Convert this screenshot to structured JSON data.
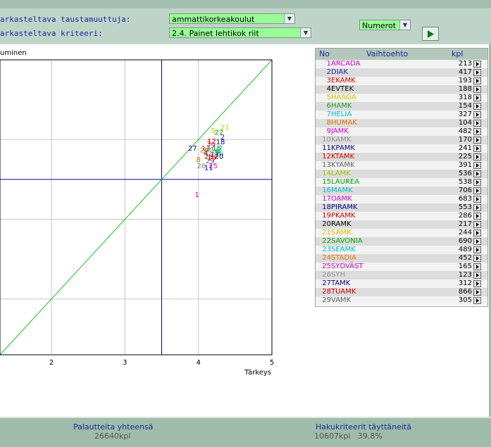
{
  "header": {
    "background_label": "arkasteltava taustamuuttuja:",
    "background_value": "ammattikorkeakoulut",
    "criterion_label": "arkasteltava kriteeri:",
    "criterion_value": "2.4. Painet lehtikok riit",
    "display_value": "Numerot"
  },
  "chart_data": {
    "type": "scatter",
    "title": "uminen",
    "xlabel": "Tärkeys",
    "x_ticks": [
      "2",
      "3",
      "4",
      "5"
    ],
    "xlim": [
      1.3,
      5
    ],
    "ylim": [
      1.3,
      5
    ],
    "grid": true,
    "reference_lines": {
      "x": 3.5,
      "y": 3.5,
      "diagonal": true
    },
    "points": [
      {
        "label": "1",
        "x": 3.98,
        "y": 3.28,
        "color": "#cc00cc"
      },
      {
        "label": "2",
        "x": 4.33,
        "y": 4.0,
        "color": "#1a1aa0"
      },
      {
        "label": "3",
        "x": 4.14,
        "y": 3.92,
        "color": "#cc0000"
      },
      {
        "label": "4",
        "x": 4.1,
        "y": 3.8,
        "color": "#000000"
      },
      {
        "label": "5",
        "x": 4.2,
        "y": 4.08,
        "color": "#e0c000"
      },
      {
        "label": "6",
        "x": 4.26,
        "y": 3.82,
        "color": "#20a020"
      },
      {
        "label": "7",
        "x": 4.3,
        "y": 3.86,
        "color": "#00c0c0"
      },
      {
        "label": "8",
        "x": 4.0,
        "y": 3.72,
        "color": "#e07000"
      },
      {
        "label": "9",
        "x": 4.2,
        "y": 3.9,
        "color": "#cc00cc"
      },
      {
        "label": "10",
        "x": 4.12,
        "y": 3.84,
        "color": "#808080"
      },
      {
        "label": "11",
        "x": 4.14,
        "y": 3.62,
        "color": "#000080"
      },
      {
        "label": "12",
        "x": 4.18,
        "y": 3.95,
        "color": "#cc0000"
      },
      {
        "label": "13",
        "x": 4.1,
        "y": 3.86,
        "color": "#606060"
      },
      {
        "label": "14",
        "x": 4.22,
        "y": 3.84,
        "color": "#a0c000"
      },
      {
        "label": "15",
        "x": 4.25,
        "y": 3.86,
        "color": "#00a000"
      },
      {
        "label": "16",
        "x": 4.28,
        "y": 3.8,
        "color": "#00c0c0"
      },
      {
        "label": "17",
        "x": 4.22,
        "y": 3.78,
        "color": "#cc00cc"
      },
      {
        "label": "18",
        "x": 4.3,
        "y": 3.94,
        "color": "#000080"
      },
      {
        "label": "19",
        "x": 4.18,
        "y": 3.74,
        "color": "#cc0000"
      },
      {
        "label": "20",
        "x": 4.28,
        "y": 3.76,
        "color": "#000000"
      },
      {
        "label": "21",
        "x": 4.36,
        "y": 4.12,
        "color": "#e0c000"
      },
      {
        "label": "22",
        "x": 4.28,
        "y": 4.06,
        "color": "#00a000"
      },
      {
        "label": "23",
        "x": 4.24,
        "y": 3.82,
        "color": "#00c0c0"
      },
      {
        "label": "24",
        "x": 4.08,
        "y": 3.84,
        "color": "#e07000"
      },
      {
        "label": "25",
        "x": 4.2,
        "y": 3.64,
        "color": "#cc00cc"
      },
      {
        "label": "26",
        "x": 4.04,
        "y": 3.64,
        "color": "#808080"
      },
      {
        "label": "27",
        "x": 3.92,
        "y": 3.86,
        "color": "#000080"
      },
      {
        "label": "28",
        "x": 4.14,
        "y": 3.76,
        "color": "#cc0000"
      },
      {
        "label": "29",
        "x": 4.16,
        "y": 3.7,
        "color": "#606060"
      }
    ]
  },
  "table": {
    "headers": {
      "no": "No",
      "name": "Vaihtoehto",
      "kpl": "kpl"
    },
    "rows": [
      {
        "no": "1",
        "name": "ARCADA",
        "kpl": "213",
        "color": "#cc00cc"
      },
      {
        "no": "2",
        "name": "DIAK",
        "kpl": "417",
        "color": "#1a1aa0"
      },
      {
        "no": "3",
        "name": "EKAMK",
        "kpl": "193",
        "color": "#cc0000"
      },
      {
        "no": "4",
        "name": "EVTEK",
        "kpl": "188",
        "color": "#000000"
      },
      {
        "no": "5",
        "name": "HAAGA",
        "kpl": "318",
        "color": "#e0c000"
      },
      {
        "no": "6",
        "name": "HAMK",
        "kpl": "154",
        "color": "#20a020"
      },
      {
        "no": "7",
        "name": "HELIA",
        "kpl": "327",
        "color": "#00c0c0"
      },
      {
        "no": "8",
        "name": "HUMAK",
        "kpl": "104",
        "color": "#e07000"
      },
      {
        "no": "9",
        "name": "JAMK",
        "kpl": "482",
        "color": "#cc00cc"
      },
      {
        "no": "10",
        "name": "KAMK",
        "kpl": "170",
        "color": "#909090"
      },
      {
        "no": "11",
        "name": "KPAMK",
        "kpl": "241",
        "color": "#000080"
      },
      {
        "no": "12",
        "name": "KTAMK",
        "kpl": "225",
        "color": "#cc0000"
      },
      {
        "no": "13",
        "name": "KYAMK",
        "kpl": "391",
        "color": "#606060"
      },
      {
        "no": "14",
        "name": "LAMK",
        "kpl": "536",
        "color": "#a0c000"
      },
      {
        "no": "15",
        "name": "LAUREA",
        "kpl": "538",
        "color": "#00a000"
      },
      {
        "no": "16",
        "name": "MAMK",
        "kpl": "706",
        "color": "#00c0c0"
      },
      {
        "no": "17",
        "name": "OAMK",
        "kpl": "683",
        "color": "#cc00cc"
      },
      {
        "no": "18",
        "name": "PIRAMK",
        "kpl": "553",
        "color": "#000080"
      },
      {
        "no": "19",
        "name": "PKAMK",
        "kpl": "286",
        "color": "#cc0000"
      },
      {
        "no": "20",
        "name": "RAMK",
        "kpl": "217",
        "color": "#000000"
      },
      {
        "no": "21",
        "name": "SAMK",
        "kpl": "244",
        "color": "#e0c000"
      },
      {
        "no": "22",
        "name": "SAVONIA",
        "kpl": "690",
        "color": "#00a000"
      },
      {
        "no": "23",
        "name": "SEAMK",
        "kpl": "489",
        "color": "#00c0c0"
      },
      {
        "no": "24",
        "name": "STADIA",
        "kpl": "452",
        "color": "#e07000"
      },
      {
        "no": "25",
        "name": "SYDVÄST",
        "kpl": "165",
        "color": "#cc00cc"
      },
      {
        "no": "26",
        "name": "SYH",
        "kpl": "123",
        "color": "#909090"
      },
      {
        "no": "27",
        "name": "TAMK",
        "kpl": "312",
        "color": "#000080"
      },
      {
        "no": "28",
        "name": "TUAMK",
        "kpl": "866",
        "color": "#cc0000"
      },
      {
        "no": "29",
        "name": "VAMK",
        "kpl": "305",
        "color": "#606060"
      }
    ]
  },
  "footer": {
    "total_label": "Palautteita yhteensä",
    "total_value": "26640kpl",
    "match_label": "Hakukriteerit täyttäneitä",
    "match_value": "10607kpl   39.8%"
  },
  "colors": {
    "accent": "#1c2a9a",
    "select_bg": "#99ff99",
    "panel": "#bfd4c8",
    "footer": "#9fbcaa"
  }
}
